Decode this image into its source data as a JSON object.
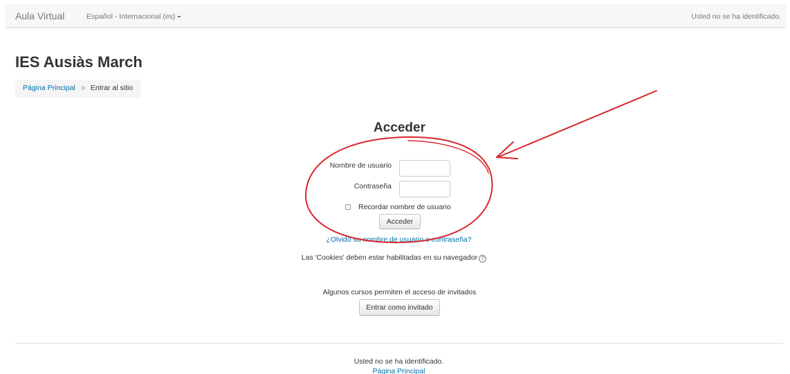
{
  "navbar": {
    "brand": "Aula Virtual",
    "language": "Español - Internacional (es)",
    "login_status": "Usted no se ha identificado."
  },
  "page": {
    "title": "IES Ausiàs March"
  },
  "breadcrumb": {
    "home": "Página Principal",
    "current": "Entrar al sitio"
  },
  "login": {
    "heading": "Acceder",
    "username_label": "Nombre de usuario",
    "username_value": "",
    "password_label": "Contraseña",
    "password_value": "",
    "remember_label": "Recordar nombre de usuario",
    "remember_checked": false,
    "submit_label": "Acceder",
    "forgot_link": "¿Olvidó su nombre de usuario o contraseña?",
    "cookies_notice": "Las 'Cookies' deben estar habilitadas en su navegador",
    "help_icon_glyph": "?"
  },
  "guest": {
    "notice": "Algunos cursos permiten el acceso de invitados",
    "button_label": "Entrar como invitado"
  },
  "footer": {
    "login_status": "Usted no se ha identificado.",
    "home_link": "Página Principal"
  },
  "annotation": {
    "color": "#d9262b",
    "shapes": [
      "ellipse",
      "arrow"
    ]
  }
}
